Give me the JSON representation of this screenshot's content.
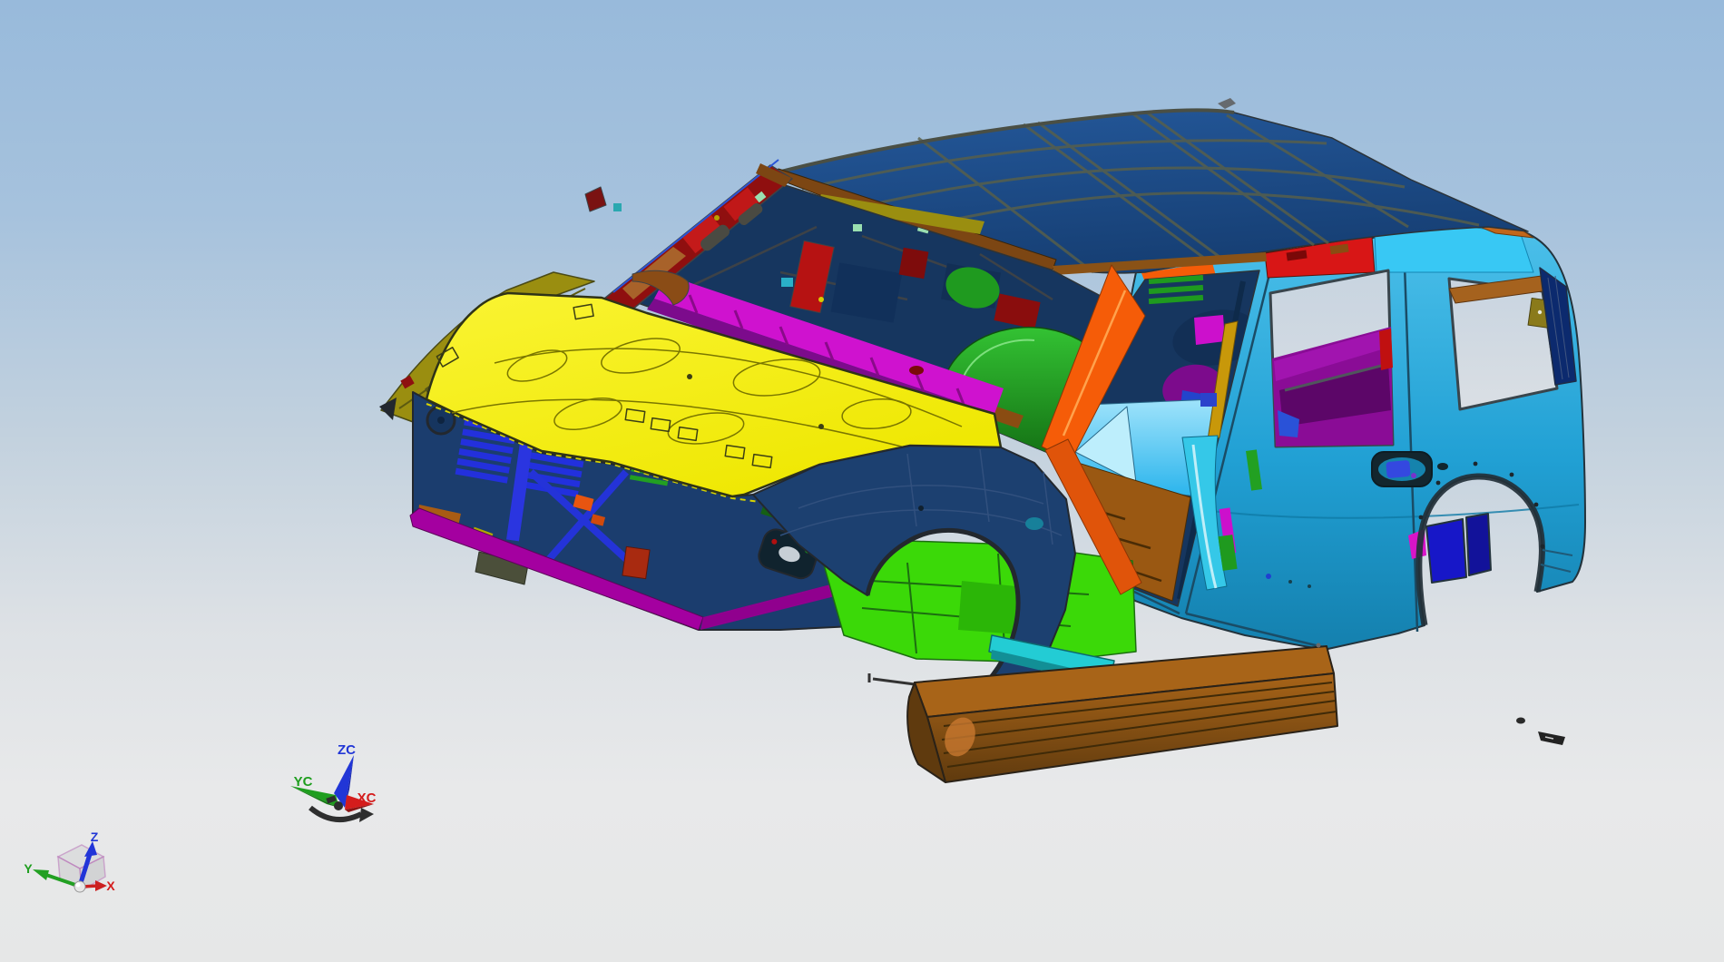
{
  "app": {
    "type": "cad-3d-viewport",
    "content": "car body-in-white multi-part model, isometric view"
  },
  "background": {
    "sky_top": "#98badb",
    "sky_mid": "#c2d1de",
    "ground": "#e8e9ea"
  },
  "triads": {
    "wcs": {
      "z": "ZC",
      "y": "YC",
      "x": "XC"
    },
    "abs": {
      "z": "Z",
      "y": "Y",
      "x": "X"
    },
    "axis_colors": {
      "x": "#d41c1c",
      "y": "#1f9e1f",
      "z": "#2136d6"
    },
    "cube_edge": "#b878b8"
  },
  "colors": {
    "roof_light": "#24589a",
    "roof_dark": "#163f74",
    "roof_grid": "#5a6048",
    "header_brown": "#7c4613",
    "rail_brown": "#8a5216",
    "roofedge_orange": "#c2661a",
    "olive_strip": "#9a8e10",
    "hood_light": "#faf433",
    "hood": "#eee700",
    "side_light": "#4cc0ea",
    "side": "#21a0d4",
    "side_dark": "#1480ae",
    "red_strip": "#d81616",
    "cyan_strip": "#38c8f4",
    "apillar_orange": "#f55c08",
    "apillar_orange_dark": "#e0540a",
    "left_apillar_red": "#8f0f0f",
    "cowl_magenta": "#cf12cf",
    "cowl_purple": "#7c0b8c",
    "navy": "#1b3d6e",
    "interior_navy": "#16365f",
    "grille_blue": "#2330dc",
    "bumper_magenta": "#a400a0",
    "green_dome_light": "#33c233",
    "green_dome_dark": "#147014",
    "floor_green": "#3bd908",
    "floor_brown": "#9a5812",
    "dash_brown": "#8a4c12",
    "floor_cyan": "#2ab4ec",
    "floor_cyan_light": "#9fe3fb",
    "sill_cyan": "#23ccd4",
    "board_light": "#a86418",
    "board_dark": "#5f3a0e",
    "tank_blue": "#1717c8",
    "tank_blue_dark": "#12129a",
    "window_purple": "#8a0c96",
    "window_purple_dark": "#5c0668",
    "quarter_bracket": "#a5621e",
    "olive_plate": "#8a7a1a",
    "dpillar_navy": "#0c2a6e",
    "bpillar_gold": "#c8980a",
    "bpillar_magenta": "#cc10cc",
    "bpillar_cyan": "#35c8e8",
    "handle_blue": "#3448e0",
    "pink_part": "#e048c8",
    "rust_part": "#a82a10",
    "step_olive": "#4b4f3a",
    "chip_orange": "#e85510",
    "lamp_silver": "#c7cfd6",
    "fender_navy": "#1c4070"
  },
  "model": {
    "parts": [
      "roof-panel",
      "windshield-header",
      "hood-panel",
      "left-apillar-inner",
      "cowl-top",
      "apillar",
      "bpillar",
      "rear-door",
      "quarter-panel",
      "dpillar-inner",
      "roof-rail-right",
      "belt-strip-red",
      "cant-strip-cyan",
      "front-fender",
      "radiator-support",
      "front-bumper-beam",
      "shock-tower",
      "front-floor",
      "mid-floor",
      "rear-floor-cyan",
      "rocker-step",
      "fuel-tank",
      "quarter-trim",
      "door-handle",
      "headlamp-pocket"
    ]
  }
}
